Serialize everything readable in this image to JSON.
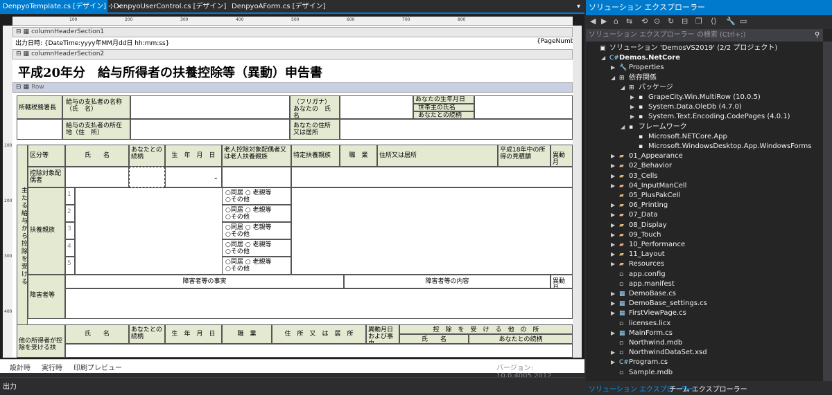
{
  "tabs": [
    "DenpyoTemplate.cs [デザイン]",
    "DenpyoUserControl.cs [デザイン]",
    "DenpyoAForm.cs [デザイン]"
  ],
  "ruler_marks": [
    "100",
    "200",
    "300",
    "400",
    "500",
    "600",
    "700",
    "800"
  ],
  "ruler_v_marks": [
    "100",
    "200",
    "300",
    "400"
  ],
  "sections": {
    "sec1": "columnHeaderSection1",
    "sec2": "columnHeaderSection2",
    "row": "Row"
  },
  "header": {
    "printed": "出力日時: {DateTime:yyyy年MM月dd日 hh:mm:ss}",
    "page": "{PageNumber"
  },
  "form_title": "平成20年分　給与所得者の扶養控除等（異動）申告書",
  "labels": {
    "office": "所轄税務署長",
    "payer_name": "給与の支払者の名称（氏　名）",
    "furigana": "（フリガナ）あなたの　氏　名",
    "birth": "あなたの生年月日",
    "householder": "世帯主の氏名",
    "relation": "あなたとの続柄",
    "payer_addr": "給与の支払者の所在地（住　所）",
    "your_addr": "あなたの住所又は居所",
    "vertical": "主たる給与から控除を受ける",
    "kubun": "区分等",
    "name": "氏　　名",
    "rel": "あなたとの続柄",
    "birthdate": "生　年　月　日",
    "elder": "老人控除対象配偶者又は老人扶養親族",
    "specific": "特定扶養親族",
    "job": "職　業",
    "address": "住所又は居所",
    "income": "平成18年中の所得の見積額",
    "idou": "異動月",
    "spouse": "控除対象配偶者",
    "dependents": "扶養親族",
    "disabled": "障害者等",
    "disabled_matter": "障害者等の事実",
    "disabled_content": "障害者等の内容",
    "other_payer": "他の所得者が控除を受ける扶",
    "addr2": "住　所　又　は　居　所",
    "idou2": "異動月日および事由",
    "deduct": "控　除　を　受　け　る　他　の　所",
    "name2": "氏　　名",
    "rel2": "あなたとの続柄",
    "live": "○同居",
    "other": "○その他",
    "old": "○ 老親等"
  },
  "row_nums": [
    "1",
    "2",
    "3",
    "4",
    "5"
  ],
  "bottom_tabs": [
    "設計時",
    "実行時",
    "印刷プレビュー"
  ],
  "version": "バージョン: 10.0.4005.2012",
  "output_title": "出力",
  "se": {
    "title": "ソリューション エクスプローラー",
    "search": "ソリューション エクスプローラー の検索 (Ctrl+;)",
    "tab1": "ソリューション エクスプローラー",
    "tab2": "チーム エクスプローラー",
    "items": [
      {
        "t": "ソリューション 'DemosVS2019' (2/2 プロジェクト)",
        "i": 0,
        "a": "",
        "ic": "▣"
      },
      {
        "t": "Demos.NetCore",
        "i": 1,
        "a": "◢",
        "ic": "C#"
      },
      {
        "t": "Properties",
        "i": 2,
        "a": "▶",
        "ic": "🔧"
      },
      {
        "t": "依存関係",
        "i": 2,
        "a": "◢",
        "ic": "⊞"
      },
      {
        "t": "パッケージ",
        "i": 3,
        "a": "◢",
        "ic": "⊞"
      },
      {
        "t": "GrapeCity.Win.MultiRow (10.0.5)",
        "i": 4,
        "a": "▶",
        "ic": "▪"
      },
      {
        "t": "System.Data.OleDb (4.7.0)",
        "i": 4,
        "a": "▶",
        "ic": "▪"
      },
      {
        "t": "System.Text.Encoding.CodePages (4.0.1)",
        "i": 4,
        "a": "▶",
        "ic": "▪"
      },
      {
        "t": "フレームワーク",
        "i": 3,
        "a": "◢",
        "ic": "▪"
      },
      {
        "t": "Microsoft.NETCore.App",
        "i": 4,
        "a": "",
        "ic": "▪"
      },
      {
        "t": "Microsoft.WindowsDesktop.App.WindowsForms",
        "i": 4,
        "a": "",
        "ic": "▪"
      },
      {
        "t": "01_Appearance",
        "i": 2,
        "a": "▶",
        "ic": "▰"
      },
      {
        "t": "02_Behavior",
        "i": 2,
        "a": "▶",
        "ic": "▰"
      },
      {
        "t": "03_Cells",
        "i": 2,
        "a": "▶",
        "ic": "▰"
      },
      {
        "t": "04_InputManCell",
        "i": 2,
        "a": "▶",
        "ic": "▰"
      },
      {
        "t": "05_PlusPakCell",
        "i": 2,
        "a": "",
        "ic": "▰"
      },
      {
        "t": "06_Printing",
        "i": 2,
        "a": "▶",
        "ic": "▰"
      },
      {
        "t": "07_Data",
        "i": 2,
        "a": "▶",
        "ic": "▰"
      },
      {
        "t": "08_Display",
        "i": 2,
        "a": "▶",
        "ic": "▰"
      },
      {
        "t": "09_Touch",
        "i": 2,
        "a": "▶",
        "ic": "▰"
      },
      {
        "t": "10_Performance",
        "i": 2,
        "a": "▶",
        "ic": "▰"
      },
      {
        "t": "11_Layout",
        "i": 2,
        "a": "▶",
        "ic": "▰"
      },
      {
        "t": "Resources",
        "i": 2,
        "a": "▶",
        "ic": "▰"
      },
      {
        "t": "app.config",
        "i": 2,
        "a": "",
        "ic": "▫"
      },
      {
        "t": "app.manifest",
        "i": 2,
        "a": "",
        "ic": "▫"
      },
      {
        "t": "DemoBase.cs",
        "i": 2,
        "a": "▶",
        "ic": "▦"
      },
      {
        "t": "DemoBase_settings.cs",
        "i": 2,
        "a": "▶",
        "ic": "▦"
      },
      {
        "t": "FirstViewPage.cs",
        "i": 2,
        "a": "▶",
        "ic": "▦"
      },
      {
        "t": "licenses.licx",
        "i": 2,
        "a": "",
        "ic": "▫"
      },
      {
        "t": "MainForm.cs",
        "i": 2,
        "a": "▶",
        "ic": "▦"
      },
      {
        "t": "Northwind.mdb",
        "i": 2,
        "a": "",
        "ic": "▫"
      },
      {
        "t": "NorthwindDataSet.xsd",
        "i": 2,
        "a": "▶",
        "ic": "▫"
      },
      {
        "t": "Program.cs",
        "i": 2,
        "a": "▶",
        "ic": "C#"
      },
      {
        "t": "Sample.mdb",
        "i": 2,
        "a": "",
        "ic": "▫"
      }
    ]
  }
}
